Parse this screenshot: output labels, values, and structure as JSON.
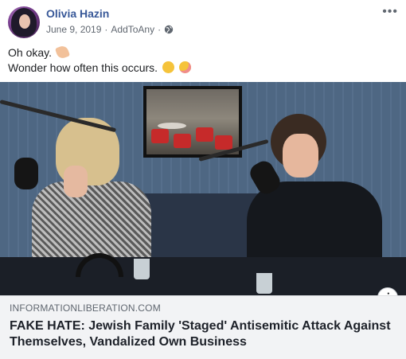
{
  "post": {
    "author": "Olivia Hazin",
    "date": "June 9, 2019",
    "separator": "·",
    "via": "AddToAny",
    "more_label": "•••",
    "text_line1": "Oh okay.",
    "text_line2": "Wonder how often this occurs."
  },
  "icons": {
    "globe": "globe-icon",
    "more": "more-options-icon",
    "info": "info-icon"
  },
  "link": {
    "domain": "INFORMATIONLIBERATION.COM",
    "headline": "FAKE HATE: Jewish Family 'Staged' Antisemitic Attack Against Themselves, Vandalized Own Business",
    "info_glyph": "i"
  },
  "colors": {
    "author": "#385898",
    "meta": "#606770",
    "link_bg": "#f2f3f5"
  }
}
